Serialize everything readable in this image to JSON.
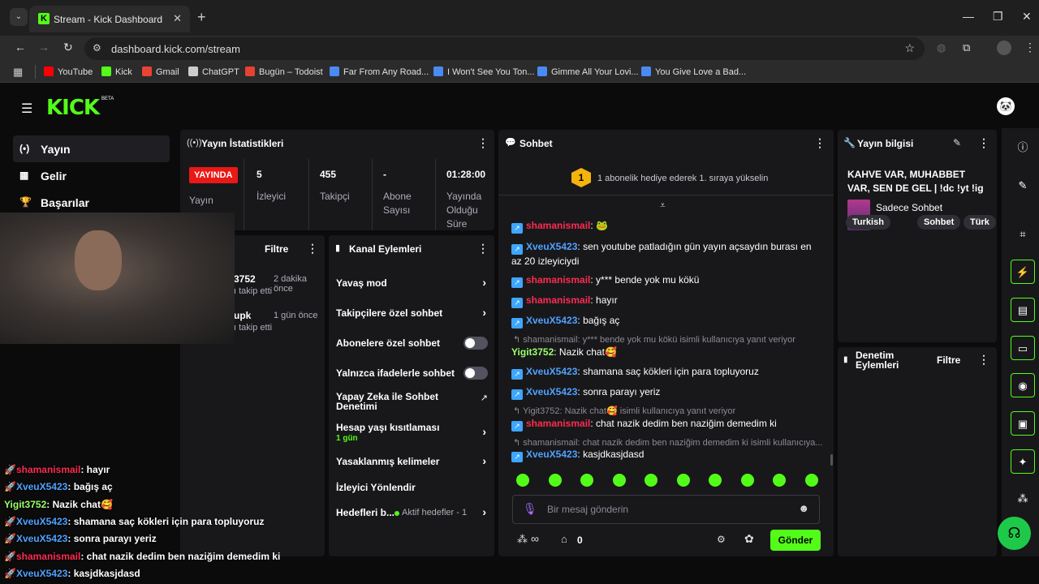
{
  "browser": {
    "tab_title": "Stream - Kick Dashboard",
    "url": "dashboard.kick.com/stream",
    "bookmarks": [
      {
        "label": "YouTube",
        "icon": "youtube-icon",
        "color": "#ff0000"
      },
      {
        "label": "Kick",
        "icon": "kick-icon",
        "color": "#53fc18"
      },
      {
        "label": "Gmail",
        "icon": "gmail-icon",
        "color": "#ea4335"
      },
      {
        "label": "ChatGPT",
        "icon": "chatgpt-icon",
        "color": "#cccccc"
      },
      {
        "label": "Bugün – Todoist",
        "icon": "todoist-icon",
        "color": "#e44232"
      },
      {
        "label": "Far From Any Road...",
        "icon": "doc-icon",
        "color": "#4a8af4"
      },
      {
        "label": "I Won't See You Ton...",
        "icon": "doc-icon",
        "color": "#4a8af4"
      },
      {
        "label": "Gimme All Your Lovi...",
        "icon": "doc-icon",
        "color": "#4a8af4"
      },
      {
        "label": "You Give Love a Bad...",
        "icon": "doc-icon",
        "color": "#4a8af4"
      }
    ]
  },
  "header": {
    "logo": "KICK",
    "beta": "BETA"
  },
  "sidebar": {
    "items": [
      {
        "label": "Yayın",
        "icon": "broadcast-icon",
        "glyph": "(•)"
      },
      {
        "label": "Gelir",
        "icon": "revenue-icon",
        "glyph": "▦"
      },
      {
        "label": "Başarılar",
        "icon": "trophy-icon",
        "glyph": "🏆"
      }
    ]
  },
  "stats": {
    "title": "Yayın İstatistikleri",
    "live_badge": "YAYINDA",
    "live_label": "Yayın",
    "viewers_value": "5",
    "viewers_label": "İzleyici",
    "followers_value": "455",
    "followers_label": "Takipçi",
    "subs_value": "-",
    "subs_label": "Abone Sayısı",
    "uptime_value": "01:28:00",
    "uptime_label": "Yayında Olduğu Süre"
  },
  "activity": {
    "filter": "Filtre",
    "items": [
      {
        "name": "3752",
        "time": "2 dakika önce",
        "sub": "ı takip etti"
      },
      {
        "name": "upk",
        "time": "1 gün önce",
        "sub": "ı takip etti"
      }
    ]
  },
  "channel_actions": {
    "title": "Kanal Eylemleri",
    "items": [
      {
        "label": "Yavaş mod"
      },
      {
        "label": "Takipçilere özel sohbet"
      },
      {
        "label": "Abonelere özel sohbet"
      },
      {
        "label": "Yalnızca ifadelerle sohbet"
      },
      {
        "label": "Yapay Zeka ile Sohbet Denetimi"
      },
      {
        "label": "Hesap yaşı kısıtlaması",
        "sub": "1 gün"
      },
      {
        "label": "Yasaklanmış kelimeler"
      },
      {
        "label": "İzleyici Yönlendir"
      },
      {
        "label": "Hedefleri b...",
        "sub": "Aktif hedefler - 1"
      }
    ]
  },
  "chat": {
    "title": "Sohbet",
    "gift_rank": "1",
    "gift_text": "1 abonelik hediye ederek 1. sıraya yükselin",
    "messages": [
      {
        "user": "shamanismail",
        "color": "#ff2b4f",
        "text": ""
      },
      {
        "user": "XveuX5423",
        "color": "#4fa3ff",
        "text": "sen youtube patladığın gün yayın açsaydın burası en az 20 izleyiciydi"
      },
      {
        "user": "shamanismail",
        "color": "#ff2b4f",
        "text": "y*** bende yok mu kökü"
      },
      {
        "user": "shamanismail",
        "color": "#ff2b4f",
        "text": "hayır"
      },
      {
        "user": "XveuX5423",
        "color": "#4fa3ff",
        "text": "bağış aç"
      },
      {
        "user": "Yigit3752",
        "color": "#9aff6b",
        "text": "Nazik chat🥰"
      },
      {
        "user": "XveuX5423",
        "color": "#4fa3ff",
        "text": "shamana saç kökleri için para topluyoruz"
      },
      {
        "user": "XveuX5423",
        "color": "#4fa3ff",
        "text": "sonra parayı yeriz"
      },
      {
        "user": "shamanismail",
        "color": "#ff2b4f",
        "text": "chat nazik dedim ben naziğim demedim ki"
      },
      {
        "user": "XveuX5423",
        "color": "#4fa3ff",
        "text": "kasjdkasjdasd"
      }
    ],
    "replies": [
      "shamanismail: y*** bende yok mu kökü isimli kullanıcıya yanıt veriyor",
      "Yigit3752: Nazik chat🥰  isimli kullanıcıya yanıt veriyor",
      "shamanismail: chat nazik dedim ben naziğim demedim ki isimli kullanıcıya..."
    ],
    "input_placeholder": "Bir mesaj gönderin",
    "points": "∞",
    "count": "0",
    "send": "Gönder"
  },
  "stream_info": {
    "title": "Yayın bilgisi",
    "stream_title": "KAHVE VAR, MUHABBET VAR, SEN DE GEL | !dc !yt !ig",
    "category": "Sadece Sohbet",
    "tags": [
      "Turkish",
      "Sohbet",
      "Türk"
    ]
  },
  "mod_actions": {
    "title": "Denetim Eylemleri",
    "filter": "Filtre"
  },
  "overlay_chat": [
    {
      "user": "shamanismail",
      "color": "#ff2b4f",
      "text": "hayır",
      "badge": true
    },
    {
      "user": "XveuX5423",
      "color": "#4fa3ff",
      "text": "bağış aç",
      "badge": true
    },
    {
      "user": "Yigit3752",
      "color": "#9aff6b",
      "text": "Nazik chat🥰",
      "badge": false
    },
    {
      "user": "XveuX5423",
      "color": "#4fa3ff",
      "text": "shamana saç kökleri için para topluyoruz",
      "badge": true
    },
    {
      "user": "XveuX5423",
      "color": "#4fa3ff",
      "text": "sonra parayı yeriz",
      "badge": true
    },
    {
      "user": "shamanismail",
      "color": "#ff2b4f",
      "text": "chat nazik dedim ben naziğim demedim ki",
      "badge": true
    },
    {
      "user": "XveuX5423",
      "color": "#4fa3ff",
      "text": "kasjdkasjdasd",
      "badge": true
    }
  ],
  "colors": {
    "accent": "#53fc18",
    "live": "#e91916",
    "panel": "#18181b"
  }
}
